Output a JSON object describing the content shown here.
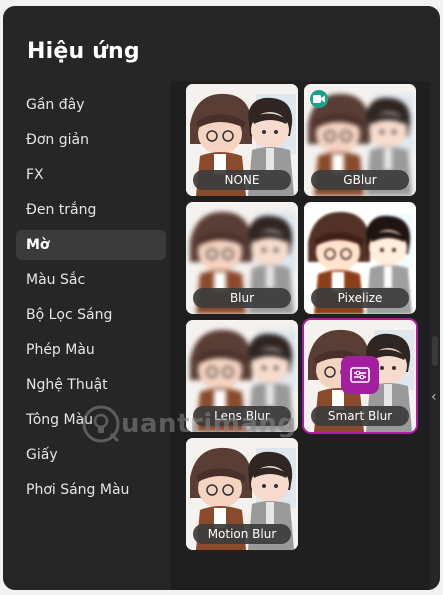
{
  "panel": {
    "title": "Hiệu ứng"
  },
  "categories": [
    {
      "label": "Gần đây",
      "active": false
    },
    {
      "label": "Đơn giản",
      "active": false
    },
    {
      "label": "FX",
      "active": false
    },
    {
      "label": "Đen trắng",
      "active": false
    },
    {
      "label": "Mờ",
      "active": true
    },
    {
      "label": "Màu Sắc",
      "active": false
    },
    {
      "label": "Bộ Lọc Sáng",
      "active": false
    },
    {
      "label": "Phép Màu",
      "active": false
    },
    {
      "label": "Nghệ Thuật",
      "active": false
    },
    {
      "label": "Tông Màu",
      "active": false
    },
    {
      "label": "Giấy",
      "active": false
    },
    {
      "label": "Phơi Sáng Màu",
      "active": false
    }
  ],
  "effects": [
    {
      "label": "NONE",
      "premium": false,
      "selected": false,
      "style": "sharp"
    },
    {
      "label": "GBlur",
      "premium": true,
      "selected": false,
      "style": "blur"
    },
    {
      "label": "Blur",
      "premium": false,
      "selected": false,
      "style": "blur"
    },
    {
      "label": "Pixelize",
      "premium": false,
      "selected": false,
      "style": "pixel"
    },
    {
      "label": "Lens Blur",
      "premium": false,
      "selected": false,
      "style": "blur"
    },
    {
      "label": "Smart Blur",
      "premium": false,
      "selected": true,
      "style": "sharp"
    },
    {
      "label": "Motion Blur",
      "premium": false,
      "selected": false,
      "style": "sharp"
    }
  ],
  "icons": {
    "premium": "video-camera-icon",
    "adjust": "sliders-icon",
    "scroll": "chevron-left-icon"
  },
  "colors": {
    "panel_bg": "#262626",
    "grid_bg": "#1f1f1f",
    "active_item_bg": "#3b3b3b",
    "selected_outline": "#b01aa0",
    "adjust_button": "#a31fa0",
    "premium_badge": "#1aa38a"
  },
  "watermark": {
    "text": "uantrimang"
  }
}
